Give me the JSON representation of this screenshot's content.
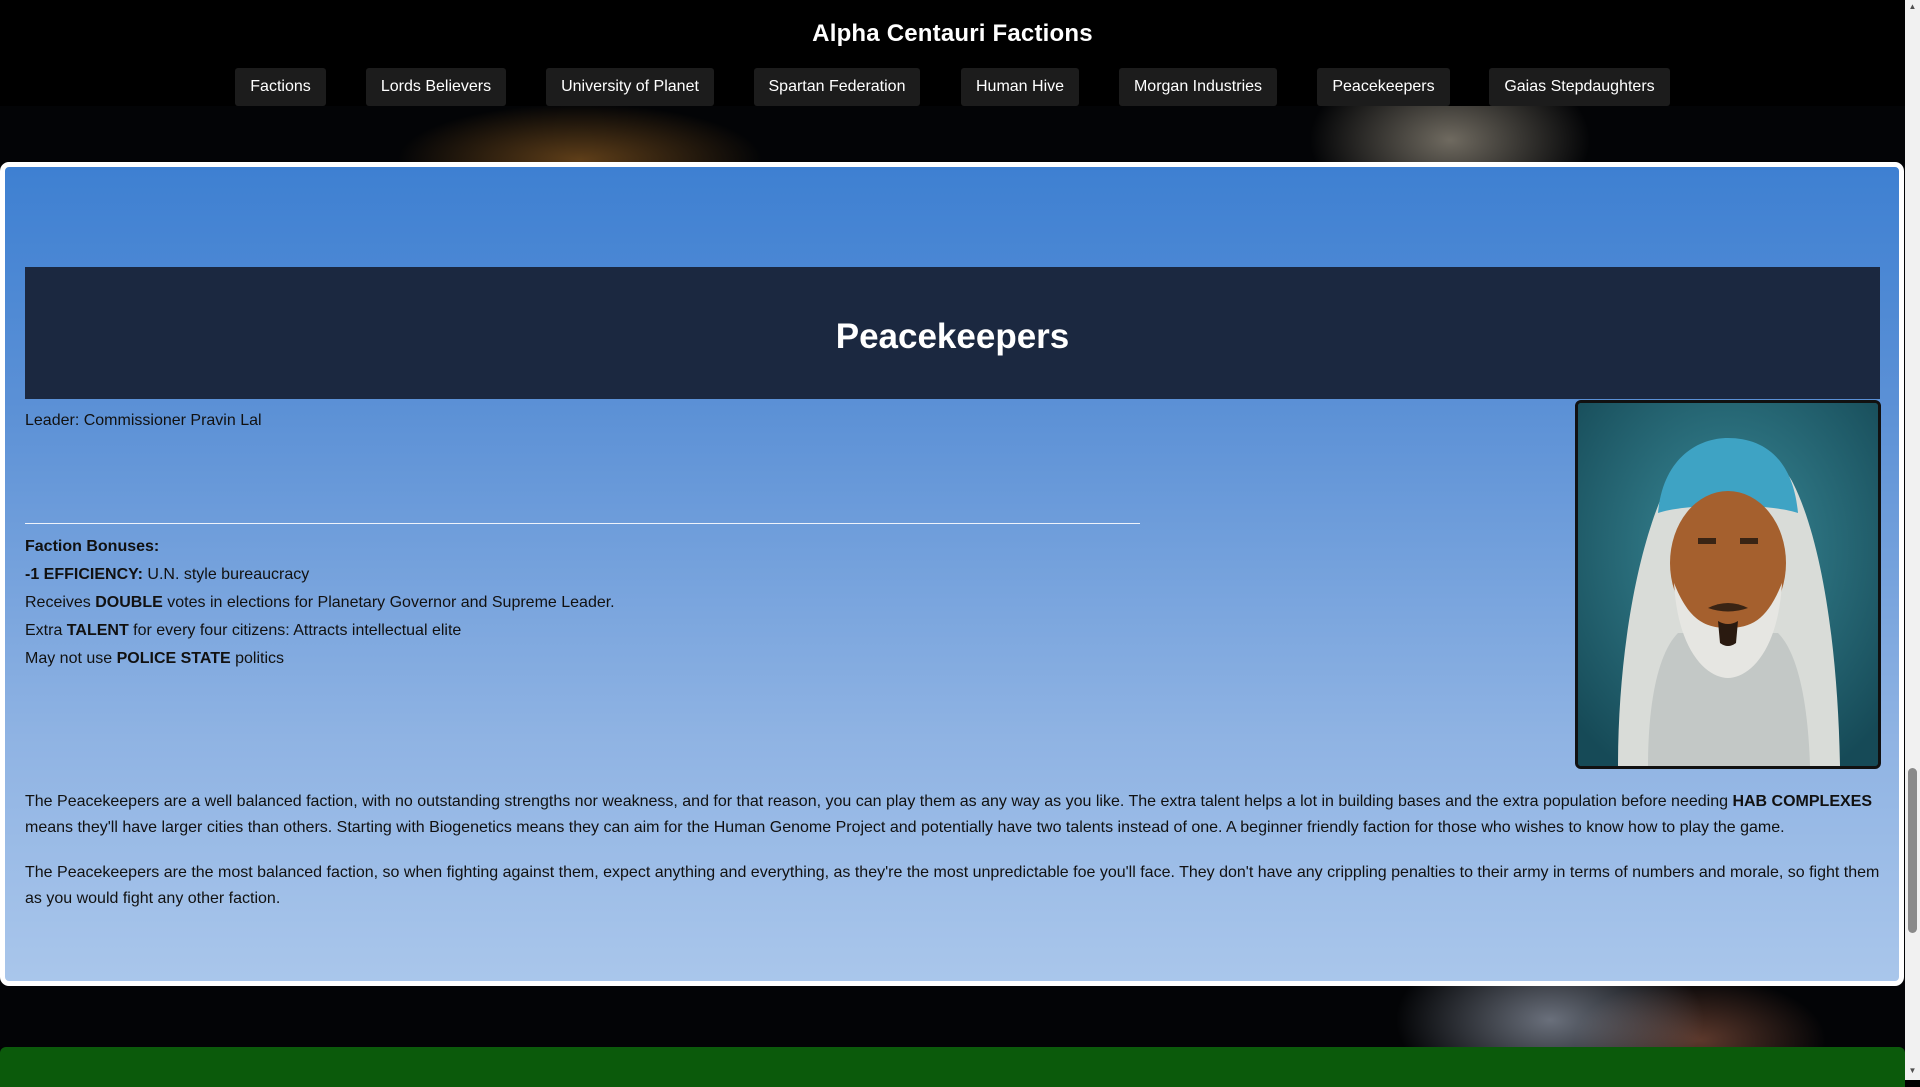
{
  "site": {
    "title": "Alpha Centauri Factions"
  },
  "nav": {
    "items": [
      {
        "label": "Factions"
      },
      {
        "label": "Lords Believers"
      },
      {
        "label": "University of Planet"
      },
      {
        "label": "Spartan Federation"
      },
      {
        "label": "Human Hive"
      },
      {
        "label": "Morgan Industries"
      },
      {
        "label": "Peacekeepers"
      },
      {
        "label": "Gaias Stepdaughters"
      }
    ]
  },
  "faction": {
    "name": "Peacekeepers",
    "leader_label": "Leader:",
    "leader_name": "Commissioner Pravin Lal",
    "bonuses_heading": "Faction Bonuses:",
    "bonuses": [
      {
        "pre": "",
        "bold": "-1 EFFICIENCY:",
        "post": " U.N. style bureaucracy"
      },
      {
        "pre": "Receives ",
        "bold": "DOUBLE",
        "post": " votes in elections for Planetary Governor and Supreme Leader."
      },
      {
        "pre": "Extra ",
        "bold": "TALENT",
        "post": " for every four citizens: Attracts intellectual elite"
      },
      {
        "pre": "May not use ",
        "bold": "POLICE STATE",
        "post": " politics"
      }
    ],
    "paragraph1": {
      "pre": "The Peacekeepers are a well balanced faction, with no outstanding strengths nor weakness, and for that reason, you can play them as any way as you like. The extra talent helps a lot in building bases and the extra population before needing ",
      "bold": "HAB COMPLEXES",
      "post": " means they'll have larger cities than others. Starting with Biogenetics means they can aim for the Human Genome Project and potentially have two talents instead of one. A beginner friendly faction for those who wishes to know how to play the game."
    },
    "paragraph2": "The Peacekeepers are the most balanced faction, so when fighting against them, expect anything and everything, as they're the most unpredictable foe you'll face. They don't have any crippling penalties to their army in terms of numbers and morale, so fight them as you would fight any other faction."
  },
  "colors": {
    "header_bg": "#000000",
    "nav_button_bg": "#1c1c1c",
    "panel_top": "#3e80d2",
    "panel_bottom": "#a9c6eb",
    "banner_bg": "#1b2840",
    "footer_green": "#0b5a0b"
  },
  "icons": {
    "portrait": "leader-portrait-image",
    "scroll_up": "scroll-up-arrow-icon",
    "scroll_down": "scroll-down-arrow-icon"
  }
}
